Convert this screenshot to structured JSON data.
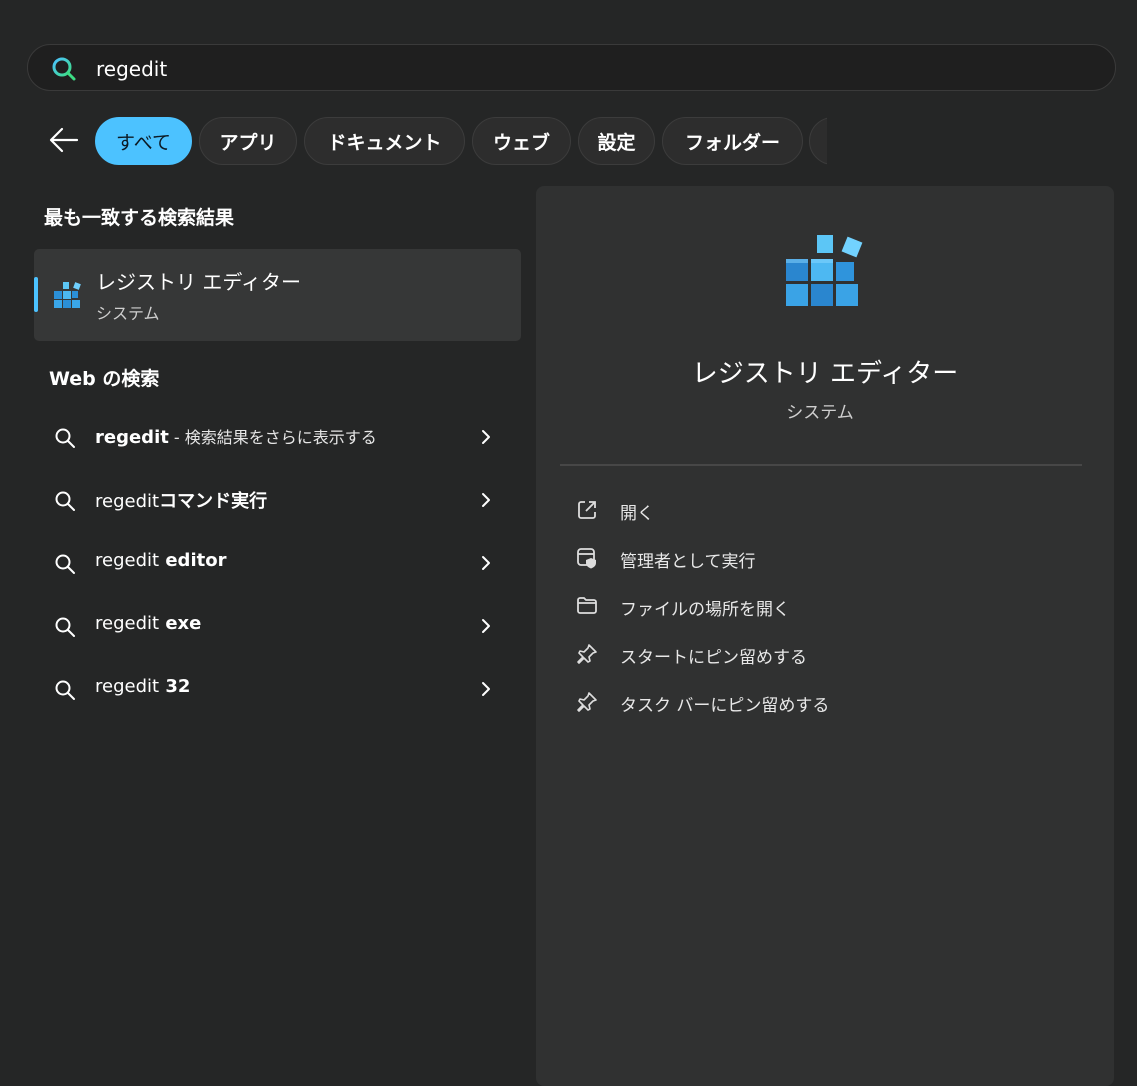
{
  "search": {
    "value": "regedit"
  },
  "filters": [
    {
      "label": "すべて",
      "active": true
    },
    {
      "label": "アプリ"
    },
    {
      "label": "ドキュメント"
    },
    {
      "label": "ウェブ"
    },
    {
      "label": "設定"
    },
    {
      "label": "フォルダー"
    }
  ],
  "best_match": {
    "heading": "最も一致する検索結果",
    "app_name": "レジストリ エディター",
    "app_type": "システム"
  },
  "web_search": {
    "heading": "Web の検索",
    "items": [
      {
        "query": "regedit",
        "suffix": " - 検索結果をさらに表示する"
      },
      {
        "query": "regedit",
        "suffix": "コマンド実行"
      },
      {
        "query": "regedit",
        "suffix": " editor"
      },
      {
        "query": "regedit",
        "suffix": " exe"
      },
      {
        "query": "regedit",
        "suffix": " 32"
      }
    ]
  },
  "detail": {
    "app_name": "レジストリ エディター",
    "app_type": "システム",
    "actions": [
      {
        "label": "開く",
        "icon": "open-external-icon"
      },
      {
        "label": "管理者として実行",
        "icon": "shield-admin-icon"
      },
      {
        "label": "ファイルの場所を開く",
        "icon": "folder-icon"
      },
      {
        "label": "スタートにピン留めする",
        "icon": "pin-icon"
      },
      {
        "label": "タスク バーにピン留めする",
        "icon": "pin-icon"
      }
    ]
  },
  "colors": {
    "accent": "#4cc2ff",
    "background": "#252626",
    "panel": "#303131"
  }
}
